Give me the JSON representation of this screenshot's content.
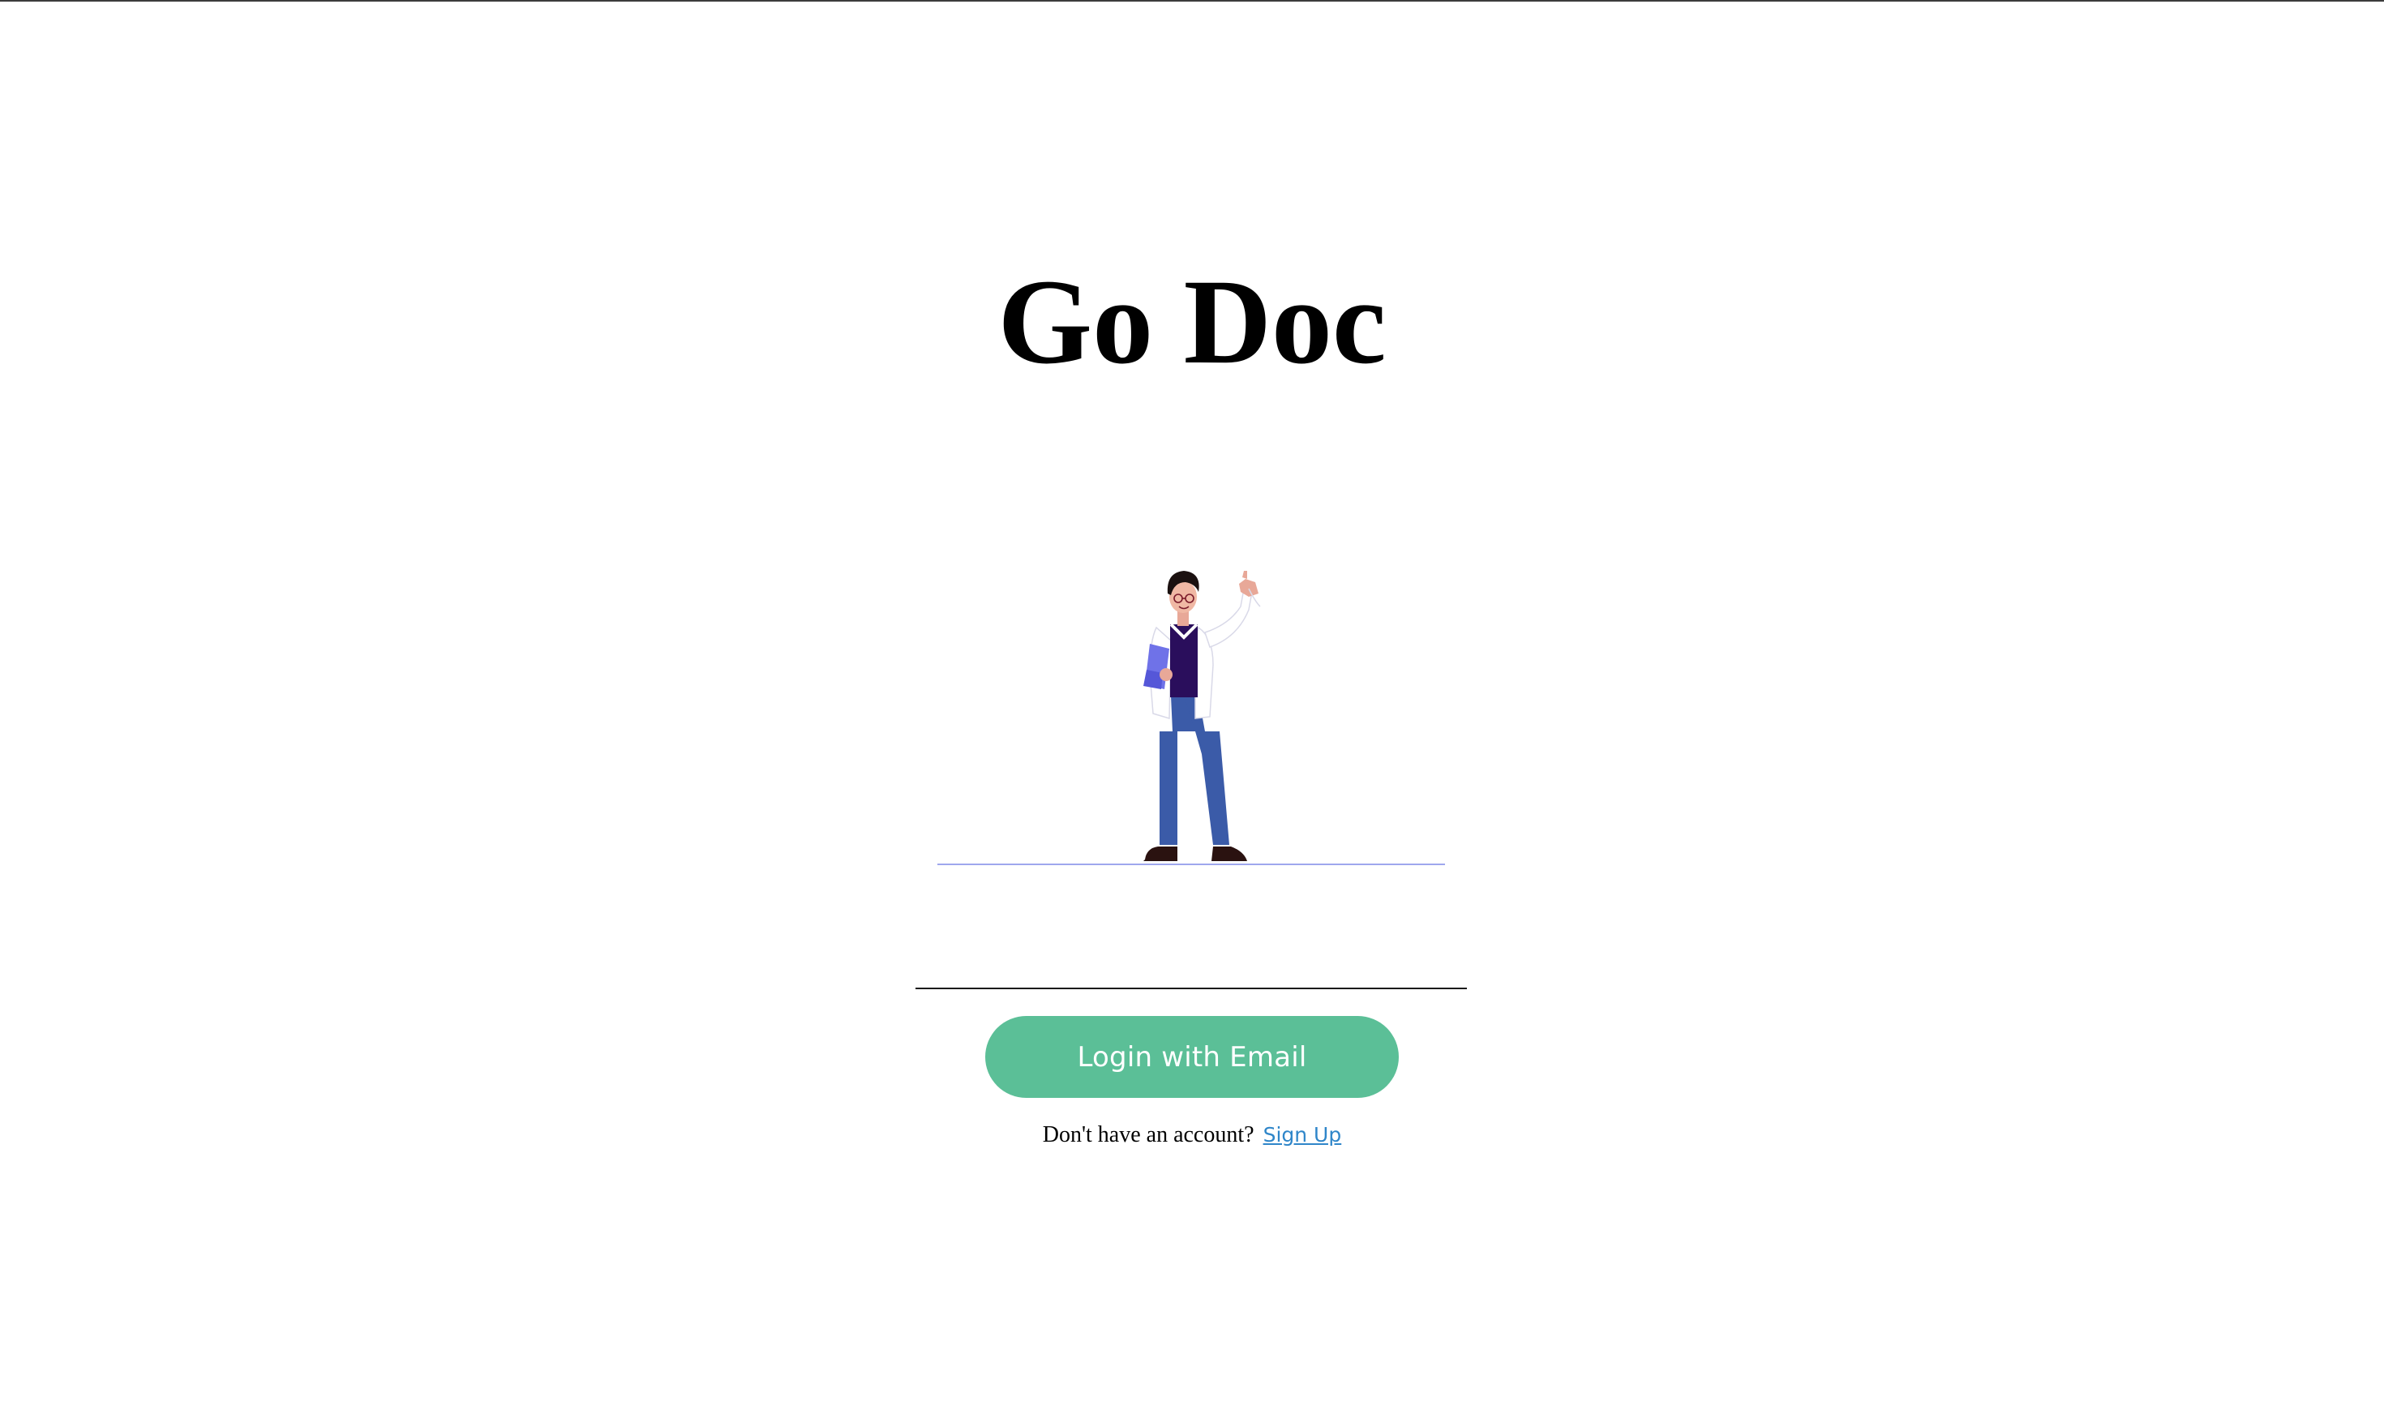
{
  "app": {
    "title": "Go Doc"
  },
  "illustration": {
    "icon": "doctor-waving-illustration",
    "colors": {
      "coat": "#ffffff",
      "shirt": "#2a0e5c",
      "pants": "#3b5ba8",
      "clipboard": "#6f72e8",
      "skin": "#e8a898",
      "hair": "#1b1110",
      "ground": "#9fa7ee"
    }
  },
  "login": {
    "email_placeholder": "",
    "button_label": "Login with Email",
    "button_color": "#5bbf97"
  },
  "signup": {
    "prompt": "Don't have an account?",
    "link_label": "Sign Up",
    "link_color": "#2f86c9"
  }
}
